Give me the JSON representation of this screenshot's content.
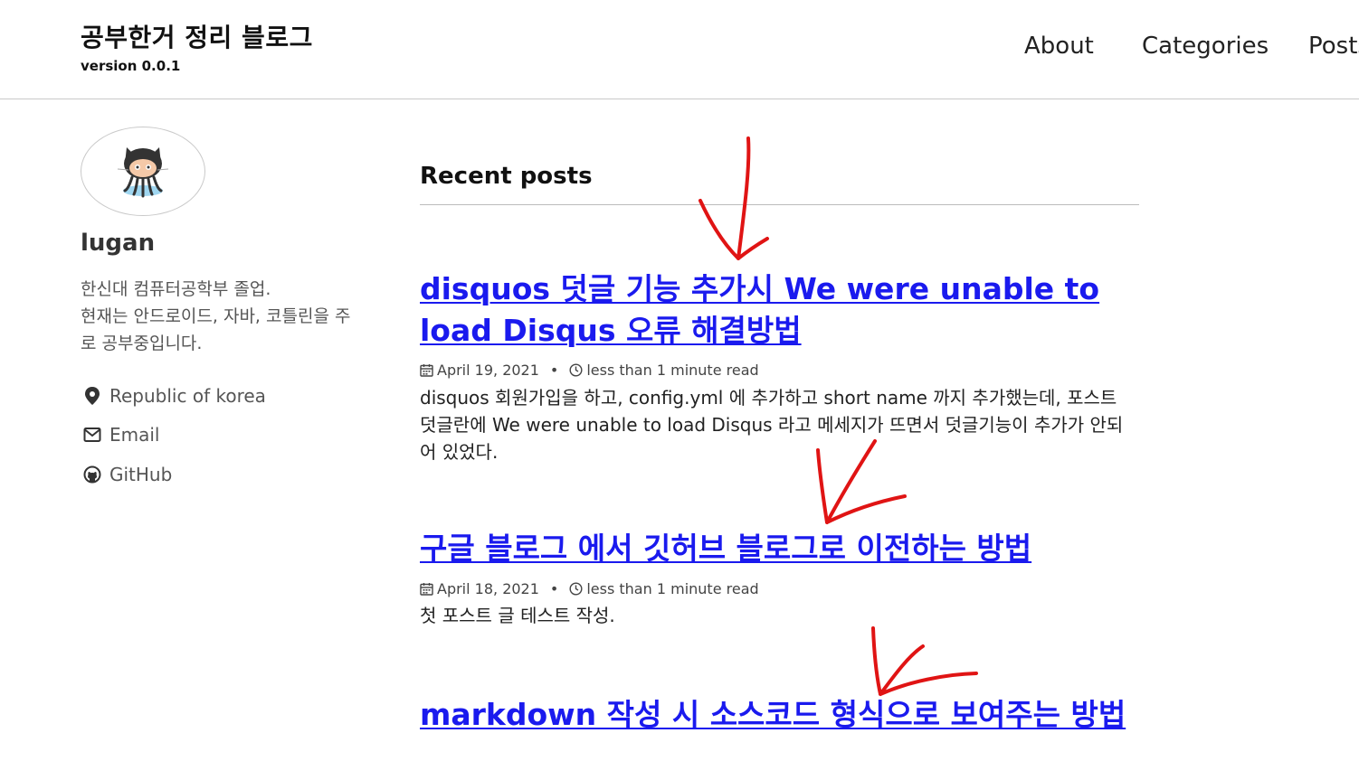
{
  "header": {
    "site_title": "공부한거 정리 블로그",
    "site_subtitle": "version 0.0.1",
    "nav": [
      {
        "label": "About"
      },
      {
        "label": "Categories"
      },
      {
        "label": "Posts"
      }
    ]
  },
  "sidebar": {
    "author_name": "lugan",
    "bio": "한신대 컴퓨터공학부 졸업.\n현재는 안드로이드, 자바, 코틀린을 주\n로 공부중입니다.",
    "links": [
      {
        "icon": "map-marker-icon",
        "label": "Republic of korea"
      },
      {
        "icon": "envelope-icon",
        "label": "Email"
      },
      {
        "icon": "github-icon",
        "label": "GitHub"
      }
    ]
  },
  "main": {
    "section_title": "Recent posts",
    "posts": [
      {
        "title": "disquos 덧글 기능 추가시 We were unable to load Disqus 오류 해결방법",
        "date": "April 19, 2021",
        "read_time": "less than 1 minute read",
        "excerpt": "disquos 회원가입을 하고, config.yml 에 추가하고 short name 까지 추가했는데, 포스트 덧글란에 We were unable to load Disqus 라고 메세지가 뜨면서 덧글기능이 추가가 안되어 있었다."
      },
      {
        "title": "구글 블로그 에서 깃허브 블로그로 이전하는 방법",
        "date": "April 18, 2021",
        "read_time": "less than 1 minute read",
        "excerpt": "첫 포스트 글 테스트 작성."
      },
      {
        "title": "markdown 작성 시 소스코드 형식으로 보여주는 방법"
      }
    ]
  },
  "annotation_color": "#e01414",
  "link_color": "#1a1aee"
}
